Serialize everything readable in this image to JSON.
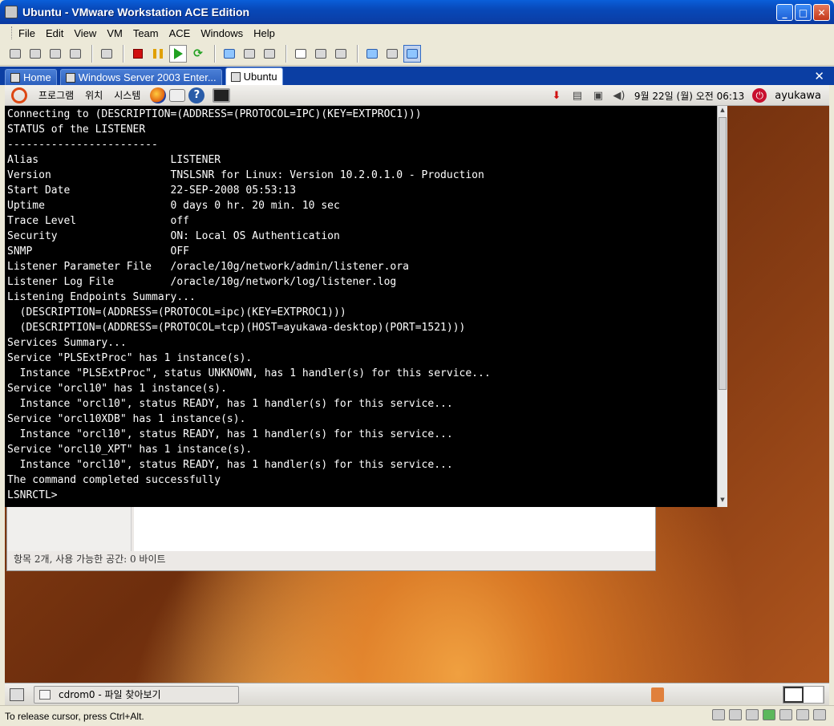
{
  "window": {
    "title": "Ubuntu - VMware Workstation ACE Edition"
  },
  "menu": [
    "File",
    "Edit",
    "View",
    "VM",
    "Team",
    "ACE",
    "Windows",
    "Help"
  ],
  "tabs": [
    {
      "label": "Home"
    },
    {
      "label": "Windows Server 2003 Enter..."
    },
    {
      "label": "Ubuntu"
    }
  ],
  "gnome_panel": {
    "menus": [
      "프로그램",
      "위치",
      "시스템"
    ],
    "clock": "9월 22일 (월) 오전 06:13",
    "user": "ayukawa"
  },
  "terminal": {
    "lines": [
      "Connecting to (DESCRIPTION=(ADDRESS=(PROTOCOL=IPC)(KEY=EXTPROC1)))",
      "STATUS of the LISTENER",
      "------------------------",
      "Alias                     LISTENER",
      "Version                   TNSLSNR for Linux: Version 10.2.0.1.0 - Production",
      "Start Date                22-SEP-2008 05:53:13",
      "Uptime                    0 days 0 hr. 20 min. 10 sec",
      "Trace Level               off",
      "Security                  ON: Local OS Authentication",
      "SNMP                      OFF",
      "Listener Parameter File   /oracle/10g/network/admin/listener.ora",
      "Listener Log File         /oracle/10g/network/log/listener.log",
      "Listening Endpoints Summary...",
      "  (DESCRIPTION=(ADDRESS=(PROTOCOL=ipc)(KEY=EXTPROC1)))",
      "  (DESCRIPTION=(ADDRESS=(PROTOCOL=tcp)(HOST=ayukawa-desktop)(PORT=1521)))",
      "Services Summary...",
      "Service \"PLSExtProc\" has 1 instance(s).",
      "  Instance \"PLSExtProc\", status UNKNOWN, has 1 handler(s) for this service...",
      "Service \"orcl10\" has 1 instance(s).",
      "  Instance \"orcl10\", status READY, has 1 handler(s) for this service...",
      "Service \"orcl10XDB\" has 1 instance(s).",
      "  Instance \"orcl10\", status READY, has 1 handler(s) for this service...",
      "Service \"orcl10_XPT\" has 1 instance(s).",
      "  Instance \"orcl10\", status READY, has 1 handler(s) for this service...",
      "The command completed successfully",
      "LSNRCTL>"
    ]
  },
  "file_manager": {
    "status": "항목 2개, 사용 가능한 공간: 0 바이트"
  },
  "bottom_panel": {
    "task": "cdrom0 - 파일 찾아보기"
  },
  "host_status": {
    "message": "To release cursor, press Ctrl+Alt."
  }
}
